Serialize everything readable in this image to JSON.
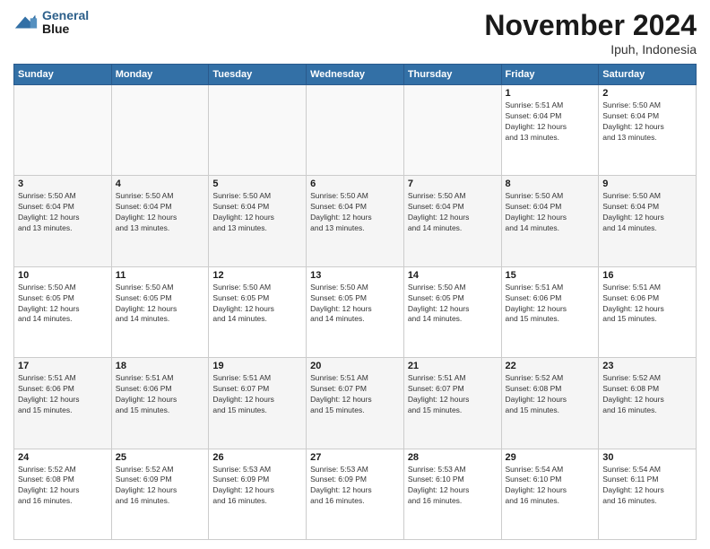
{
  "header": {
    "logo_line1": "General",
    "logo_line2": "Blue",
    "month_title": "November 2024",
    "location": "Ipuh, Indonesia"
  },
  "weekdays": [
    "Sunday",
    "Monday",
    "Tuesday",
    "Wednesday",
    "Thursday",
    "Friday",
    "Saturday"
  ],
  "weeks": [
    [
      {
        "day": "",
        "info": ""
      },
      {
        "day": "",
        "info": ""
      },
      {
        "day": "",
        "info": ""
      },
      {
        "day": "",
        "info": ""
      },
      {
        "day": "",
        "info": ""
      },
      {
        "day": "1",
        "info": "Sunrise: 5:51 AM\nSunset: 6:04 PM\nDaylight: 12 hours\nand 13 minutes."
      },
      {
        "day": "2",
        "info": "Sunrise: 5:50 AM\nSunset: 6:04 PM\nDaylight: 12 hours\nand 13 minutes."
      }
    ],
    [
      {
        "day": "3",
        "info": "Sunrise: 5:50 AM\nSunset: 6:04 PM\nDaylight: 12 hours\nand 13 minutes."
      },
      {
        "day": "4",
        "info": "Sunrise: 5:50 AM\nSunset: 6:04 PM\nDaylight: 12 hours\nand 13 minutes."
      },
      {
        "day": "5",
        "info": "Sunrise: 5:50 AM\nSunset: 6:04 PM\nDaylight: 12 hours\nand 13 minutes."
      },
      {
        "day": "6",
        "info": "Sunrise: 5:50 AM\nSunset: 6:04 PM\nDaylight: 12 hours\nand 13 minutes."
      },
      {
        "day": "7",
        "info": "Sunrise: 5:50 AM\nSunset: 6:04 PM\nDaylight: 12 hours\nand 14 minutes."
      },
      {
        "day": "8",
        "info": "Sunrise: 5:50 AM\nSunset: 6:04 PM\nDaylight: 12 hours\nand 14 minutes."
      },
      {
        "day": "9",
        "info": "Sunrise: 5:50 AM\nSunset: 6:04 PM\nDaylight: 12 hours\nand 14 minutes."
      }
    ],
    [
      {
        "day": "10",
        "info": "Sunrise: 5:50 AM\nSunset: 6:05 PM\nDaylight: 12 hours\nand 14 minutes."
      },
      {
        "day": "11",
        "info": "Sunrise: 5:50 AM\nSunset: 6:05 PM\nDaylight: 12 hours\nand 14 minutes."
      },
      {
        "day": "12",
        "info": "Sunrise: 5:50 AM\nSunset: 6:05 PM\nDaylight: 12 hours\nand 14 minutes."
      },
      {
        "day": "13",
        "info": "Sunrise: 5:50 AM\nSunset: 6:05 PM\nDaylight: 12 hours\nand 14 minutes."
      },
      {
        "day": "14",
        "info": "Sunrise: 5:50 AM\nSunset: 6:05 PM\nDaylight: 12 hours\nand 14 minutes."
      },
      {
        "day": "15",
        "info": "Sunrise: 5:51 AM\nSunset: 6:06 PM\nDaylight: 12 hours\nand 15 minutes."
      },
      {
        "day": "16",
        "info": "Sunrise: 5:51 AM\nSunset: 6:06 PM\nDaylight: 12 hours\nand 15 minutes."
      }
    ],
    [
      {
        "day": "17",
        "info": "Sunrise: 5:51 AM\nSunset: 6:06 PM\nDaylight: 12 hours\nand 15 minutes."
      },
      {
        "day": "18",
        "info": "Sunrise: 5:51 AM\nSunset: 6:06 PM\nDaylight: 12 hours\nand 15 minutes."
      },
      {
        "day": "19",
        "info": "Sunrise: 5:51 AM\nSunset: 6:07 PM\nDaylight: 12 hours\nand 15 minutes."
      },
      {
        "day": "20",
        "info": "Sunrise: 5:51 AM\nSunset: 6:07 PM\nDaylight: 12 hours\nand 15 minutes."
      },
      {
        "day": "21",
        "info": "Sunrise: 5:51 AM\nSunset: 6:07 PM\nDaylight: 12 hours\nand 15 minutes."
      },
      {
        "day": "22",
        "info": "Sunrise: 5:52 AM\nSunset: 6:08 PM\nDaylight: 12 hours\nand 15 minutes."
      },
      {
        "day": "23",
        "info": "Sunrise: 5:52 AM\nSunset: 6:08 PM\nDaylight: 12 hours\nand 16 minutes."
      }
    ],
    [
      {
        "day": "24",
        "info": "Sunrise: 5:52 AM\nSunset: 6:08 PM\nDaylight: 12 hours\nand 16 minutes."
      },
      {
        "day": "25",
        "info": "Sunrise: 5:52 AM\nSunset: 6:09 PM\nDaylight: 12 hours\nand 16 minutes."
      },
      {
        "day": "26",
        "info": "Sunrise: 5:53 AM\nSunset: 6:09 PM\nDaylight: 12 hours\nand 16 minutes."
      },
      {
        "day": "27",
        "info": "Sunrise: 5:53 AM\nSunset: 6:09 PM\nDaylight: 12 hours\nand 16 minutes."
      },
      {
        "day": "28",
        "info": "Sunrise: 5:53 AM\nSunset: 6:10 PM\nDaylight: 12 hours\nand 16 minutes."
      },
      {
        "day": "29",
        "info": "Sunrise: 5:54 AM\nSunset: 6:10 PM\nDaylight: 12 hours\nand 16 minutes."
      },
      {
        "day": "30",
        "info": "Sunrise: 5:54 AM\nSunset: 6:11 PM\nDaylight: 12 hours\nand 16 minutes."
      }
    ]
  ]
}
